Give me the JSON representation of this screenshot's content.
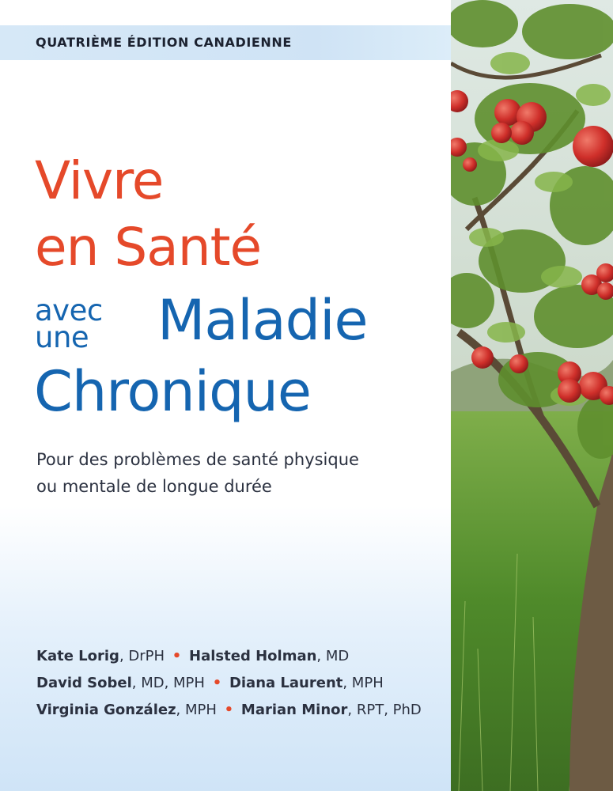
{
  "edition": "QUATRIÈME ÉDITION CANADIENNE",
  "title": {
    "line1": "Vivre",
    "line2": "en Santé",
    "small1": "avec",
    "small2": "une",
    "line5": "Maladie",
    "line6": "Chronique"
  },
  "subtitle": {
    "line1": "Pour des problèmes de santé physique",
    "line2": "ou mentale de longue durée"
  },
  "authors": [
    {
      "name": "Kate Lorig",
      "credentials": ", DrPH"
    },
    {
      "name": "Halsted Holman",
      "credentials": ", MD"
    },
    {
      "name": "David Sobel",
      "credentials": ", MD, MPH"
    },
    {
      "name": "Diana Laurent",
      "credentials": ", MPH"
    },
    {
      "name": "Virginia González",
      "credentials": ", MPH"
    },
    {
      "name": "Marian Minor",
      "credentials": ", RPT, PhD"
    }
  ],
  "separator": "•",
  "colors": {
    "title_red": "#e5492a",
    "title_blue": "#1565b0",
    "separator_red": "#e5492a",
    "band": "#d6e8f7"
  },
  "image": "apple-tree-orchard-photo"
}
